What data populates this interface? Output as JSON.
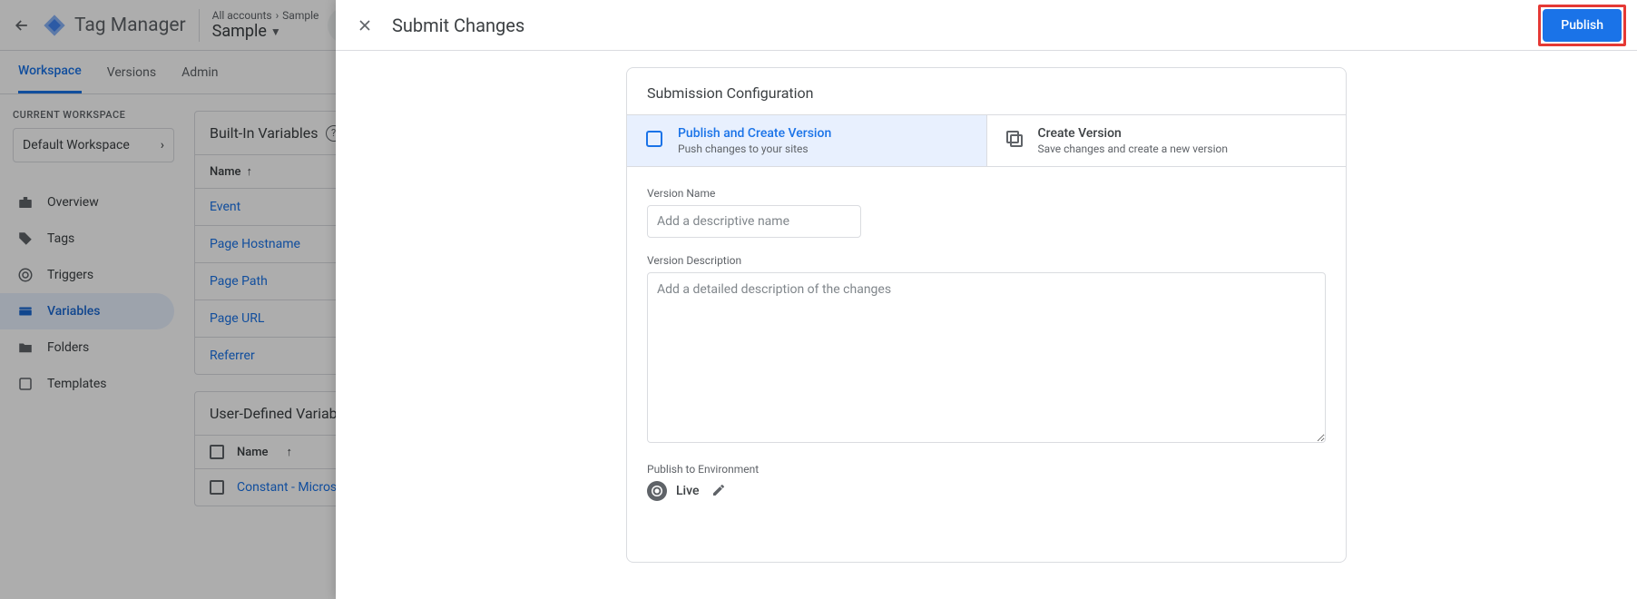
{
  "header": {
    "product": "Tag Manager",
    "crumb_all": "All accounts",
    "crumb_account": "Sample",
    "container": "Sample"
  },
  "tabs": {
    "workspace": "Workspace",
    "versions": "Versions",
    "admin": "Admin"
  },
  "sidebar": {
    "current_label": "CURRENT WORKSPACE",
    "current_value": "Default Workspace",
    "items": [
      {
        "label": "Overview"
      },
      {
        "label": "Tags"
      },
      {
        "label": "Triggers"
      },
      {
        "label": "Variables"
      },
      {
        "label": "Folders"
      },
      {
        "label": "Templates"
      }
    ]
  },
  "builtins": {
    "title": "Built-In Variables",
    "name_col": "Name",
    "rows": [
      "Event",
      "Page Hostname",
      "Page Path",
      "Page URL",
      "Referrer"
    ]
  },
  "userdef": {
    "title": "User-Defined Variables",
    "name_col": "Name",
    "rows": [
      "Constant - Microsoft"
    ]
  },
  "modal": {
    "title": "Submit Changes",
    "publish_btn": "Publish",
    "config_title": "Submission Configuration",
    "opt1_title": "Publish and Create Version",
    "opt1_sub": "Push changes to your sites",
    "opt2_title": "Create Version",
    "opt2_sub": "Save changes and create a new version",
    "version_name_label": "Version Name",
    "version_name_ph": "Add a descriptive name",
    "version_desc_label": "Version Description",
    "version_desc_ph": "Add a detailed description of the changes",
    "env_label": "Publish to Environment",
    "env_value": "Live"
  }
}
